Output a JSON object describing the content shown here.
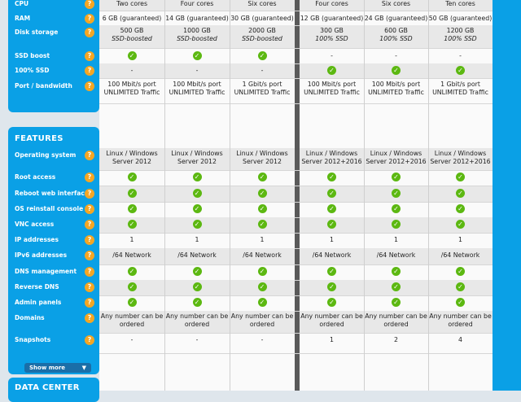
{
  "top_section": {
    "rows": [
      {
        "label": "CPU",
        "cells": [
          "Two cores",
          "Four cores",
          "Six cores",
          "Four cores",
          "Six cores",
          "Ten cores"
        ]
      },
      {
        "label": "RAM",
        "cells": [
          "6 GB (guaranteed)",
          "14 GB (guaranteed)",
          "30 GB (guaranteed)",
          "12 GB (guaranteed)",
          "24 GB (guaranteed)",
          "50 GB (guaranteed)"
        ]
      },
      {
        "label": "Disk storage",
        "cells": [
          [
            "500 GB",
            "SSD-boosted"
          ],
          [
            "1000 GB",
            "SSD-boosted"
          ],
          [
            "2000 GB",
            "SSD-boosted"
          ],
          [
            "300 GB",
            "100% SSD"
          ],
          [
            "600 GB",
            "100% SSD"
          ],
          [
            "1200 GB",
            "100% SSD"
          ]
        ]
      },
      {
        "label": "SSD boost",
        "cells": [
          "check",
          "check",
          "check",
          "-",
          "-",
          "-"
        ]
      },
      {
        "label": "100% SSD",
        "cells": [
          "-",
          "-",
          "-",
          "check",
          "check",
          "check"
        ]
      },
      {
        "label": "Port / bandwidth",
        "cells": [
          [
            "100 Mbit/s port",
            "UNLIMITED Traffic"
          ],
          [
            "100 Mbit/s port",
            "UNLIMITED Traffic"
          ],
          [
            "1 Gbit/s port",
            "UNLIMITED Traffic"
          ],
          [
            "100 Mbit/s port",
            "UNLIMITED Traffic"
          ],
          [
            "100 Mbit/s port",
            "UNLIMITED Traffic"
          ],
          [
            "1 Gbit/s port",
            "UNLIMITED Traffic"
          ]
        ]
      }
    ]
  },
  "features": {
    "title": "FEATURES",
    "rows": [
      {
        "label": "Operating system",
        "cells": [
          [
            "Linux / Windows",
            "Server 2012"
          ],
          [
            "Linux / Windows",
            "Server 2012"
          ],
          [
            "Linux / Windows",
            "Server 2012"
          ],
          [
            "Linux / Windows",
            "Server 2012+2016"
          ],
          [
            "Linux / Windows",
            "Server 2012+2016"
          ],
          [
            "Linux / Windows",
            "Server 2012+2016"
          ]
        ]
      },
      {
        "label": "Root access",
        "cells": [
          "check",
          "check",
          "check",
          "check",
          "check",
          "check"
        ]
      },
      {
        "label": "Reboot web interface",
        "cells": [
          "check",
          "check",
          "check",
          "check",
          "check",
          "check"
        ]
      },
      {
        "label": "OS reinstall console",
        "cells": [
          "check",
          "check",
          "check",
          "check",
          "check",
          "check"
        ]
      },
      {
        "label": "VNC access",
        "cells": [
          "check",
          "check",
          "check",
          "check",
          "check",
          "check"
        ]
      },
      {
        "label": "IP addresses",
        "cells": [
          "1",
          "1",
          "1",
          "1",
          "1",
          "1"
        ]
      },
      {
        "label": "IPv6 addresses",
        "cells": [
          "/64 Network",
          "/64 Network",
          "/64 Network",
          "/64 Network",
          "/64 Network",
          "/64 Network"
        ]
      },
      {
        "label": "DNS management",
        "cells": [
          "check",
          "check",
          "check",
          "check",
          "check",
          "check"
        ]
      },
      {
        "label": "Reverse DNS",
        "cells": [
          "check",
          "check",
          "check",
          "check",
          "check",
          "check"
        ]
      },
      {
        "label": "Admin panels",
        "cells": [
          "check",
          "check",
          "check",
          "check",
          "check",
          "check"
        ]
      },
      {
        "label": "Domains",
        "cells": [
          [
            "Any number can be",
            "ordered"
          ],
          [
            "Any number can be",
            "ordered"
          ],
          [
            "Any number can be",
            "ordered"
          ],
          [
            "Any number can be",
            "ordered"
          ],
          [
            "Any number can be",
            "ordered"
          ],
          [
            "Any number can be",
            "ordered"
          ]
        ]
      },
      {
        "label": "Snapshots",
        "cells": [
          "-",
          "-",
          "-",
          "1",
          "2",
          "4"
        ]
      }
    ],
    "show_more": "Show more"
  },
  "data_center": {
    "title": "DATA CENTER"
  },
  "help_icon_glyph": "?",
  "check_glyph": "✓",
  "colors": {
    "sidebar_blue": "#0aa0e6",
    "check_green": "#5cb811",
    "help_orange": "#f5a623"
  }
}
